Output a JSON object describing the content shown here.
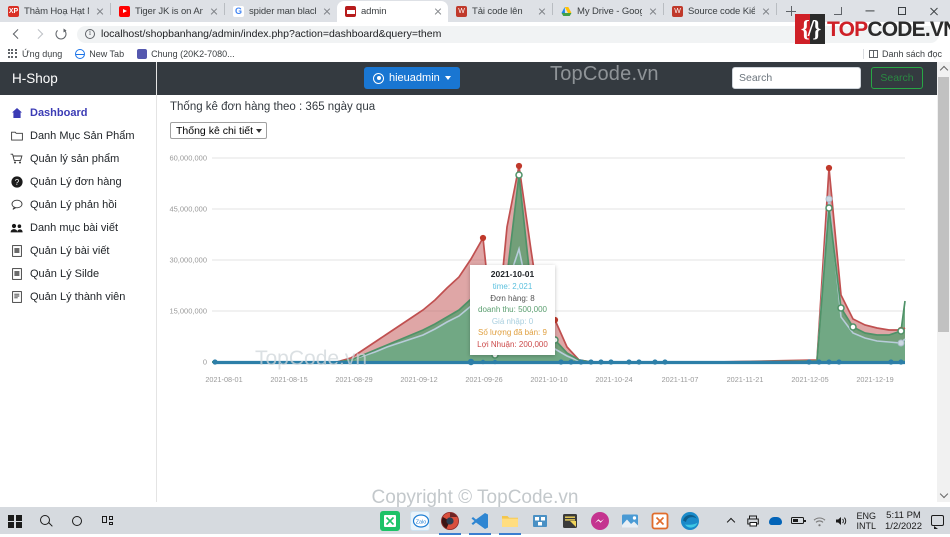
{
  "browser": {
    "tabs": [
      {
        "title": "Thảm Hoạ Hạt Nhân",
        "favicon": "xp-icon",
        "active": false
      },
      {
        "title": "Tiger JK is on Another",
        "favicon": "youtube-icon",
        "active": false
      },
      {
        "title": "spider man black hình",
        "favicon": "google-icon",
        "active": false
      },
      {
        "title": "admin",
        "favicon": "admin-icon",
        "active": true
      },
      {
        "title": "Tải code lên",
        "favicon": "word-icon",
        "active": false
      },
      {
        "title": "My Drive - Google Dr",
        "favicon": "google-drive-icon",
        "active": false
      },
      {
        "title": "Source code Kiểm tra",
        "favicon": "word-icon",
        "active": false
      }
    ],
    "new_tab_label": "+",
    "url": "localhost/shopbanhang/admin/index.php?action=dashboard&query=them",
    "bookmarks": [
      {
        "label": "Ứng dụng",
        "icon": "apps-grid-icon"
      },
      {
        "label": "New Tab",
        "icon": "globe-icon"
      },
      {
        "label": "Chung (20K2-7080...",
        "icon": "teams-icon"
      }
    ],
    "reading_list_label": "Danh sách đọc"
  },
  "watermark": {
    "logo_part1": "TOP",
    "logo_part2": "CODE.VN",
    "logo_brace": "{/}",
    "navbar_text": "TopCode.vn",
    "chart_text": "TopCode.vn",
    "copyright_text": "Copyright © TopCode.vn"
  },
  "sidebar": {
    "brand": "H-Shop",
    "items": [
      {
        "label": "Dashboard",
        "icon": "home-icon",
        "glyph": "⌂",
        "active": true
      },
      {
        "label": "Danh Mục Sản Phẩm",
        "icon": "folder-icon",
        "glyph": "὜0",
        "active": false
      },
      {
        "label": "Quản lý sản phẩm",
        "icon": "cart-icon",
        "glyph": "Ὥ2",
        "active": false
      },
      {
        "label": "Quản Lý đơn hàng",
        "icon": "question-circle-icon",
        "glyph": "❓",
        "active": false
      },
      {
        "label": "Quản Lý phản hồi",
        "icon": "comment-icon",
        "glyph": "὞8",
        "active": false
      },
      {
        "label": "Danh mục bài viết",
        "icon": "users-icon",
        "glyph": "὆5",
        "active": false
      },
      {
        "label": "Quản Lý bài viết",
        "icon": "file-icon",
        "glyph": "὜E",
        "active": false
      },
      {
        "label": "Quản Lý Silde",
        "icon": "file-icon",
        "glyph": "὜E",
        "active": false
      },
      {
        "label": "Quản Lý thành viên",
        "icon": "file-icon",
        "glyph": "὜E",
        "active": false
      }
    ]
  },
  "navbar": {
    "user_label": "hieuadmin",
    "search_placeholder": "Search",
    "search_value": "",
    "search_button": "Search",
    "accent_blue": "#1976d2",
    "accent_green": "#28a745"
  },
  "main": {
    "heading": "Thống kê đơn hàng theo : 365 ngày qua",
    "select_value": "Thống kê chi tiết"
  },
  "tooltip": {
    "title": "2021-10-01",
    "rows": [
      {
        "label": "time",
        "value": "2,021",
        "color": "#5bc0de"
      },
      {
        "label": "Đơn hàng",
        "value": "8",
        "color": "#555555"
      },
      {
        "label": "doanh thu",
        "value": "500,000",
        "color": "#5a9e6f"
      },
      {
        "label": "Giá nhập",
        "value": "0",
        "color": "#9fcfe0"
      },
      {
        "label": "Số lượng đã bán",
        "value": "9",
        "color": "#e8a33d"
      },
      {
        "label": "Lợi Nhuận",
        "value": "200,000",
        "color": "#cc4b4b"
      }
    ]
  },
  "chart_data": {
    "type": "area",
    "title": "Thống kê đơn hàng theo : 365 ngày qua",
    "xlabel": "",
    "ylabel": "",
    "ylim": [
      0,
      60000000
    ],
    "yticks": [
      0,
      15000000,
      30000000,
      45000000,
      60000000
    ],
    "ytick_labels": [
      "0",
      "15,000,000",
      "30,000,000",
      "45,000,000",
      "60,000,000"
    ],
    "grid": true,
    "legend": "none",
    "xtick_labels": [
      "2021-08-01",
      "2021-08-15",
      "2021-08-29",
      "2021-09-12",
      "2021-09-26",
      "2021-10-10",
      "2021-10-24",
      "2021-11-07",
      "2021-11-21",
      "2021-12-05",
      "2021-12-19"
    ],
    "series": [
      {
        "name": "doanh thu",
        "color": "#5a9e6f",
        "fill": "rgba(92,158,111,0.75)",
        "values": [
          0,
          0,
          0,
          0,
          0,
          0,
          0,
          0,
          0,
          0,
          0,
          0,
          0,
          0,
          0,
          0,
          0,
          0,
          0,
          0,
          0,
          0,
          500000,
          2000000,
          3500000,
          5000000,
          6500000,
          8000000,
          9500000,
          11000000,
          13000000,
          15500000,
          18000000,
          22000000,
          26000000,
          2000000,
          30000000,
          55000000,
          22000000,
          5500000,
          6500000,
          3000000,
          500000,
          0,
          0,
          0,
          0,
          0,
          0,
          0,
          0,
          0,
          0,
          0,
          0,
          0,
          0,
          0,
          0,
          0,
          0,
          0,
          0,
          0,
          0,
          0,
          0,
          0,
          0,
          0,
          0,
          0,
          0,
          0,
          0,
          0,
          0,
          500000,
          45000000,
          16000000,
          10000000,
          8000000,
          7500000,
          7000000,
          7000000,
          7500000,
          9000000,
          18000000,
          1000000,
          0
        ]
      },
      {
        "name": "Lợi Nhuận",
        "color": "#cc4b4b",
        "fill": "rgba(196,92,92,0.55)",
        "values": [
          0,
          0,
          0,
          0,
          0,
          0,
          0,
          0,
          0,
          0,
          0,
          0,
          0,
          0,
          0,
          0,
          0,
          0,
          0,
          0,
          0,
          0,
          800000,
          2600000,
          4300000,
          6000000,
          7800000,
          9500000,
          11200000,
          13000000,
          15200000,
          18000000,
          20500000,
          25000000,
          30000000,
          2500000,
          34000000,
          58000000,
          25000000,
          7500000,
          9500000,
          3500000,
          700000,
          0,
          0,
          0,
          0,
          0,
          0,
          0,
          0,
          0,
          0,
          0,
          0,
          0,
          0,
          0,
          0,
          0,
          0,
          0,
          0,
          0,
          0,
          0,
          0,
          0,
          0,
          0,
          0,
          0,
          0,
          0,
          0,
          0,
          0,
          700000,
          58000000,
          20000000,
          13000000,
          11000000,
          10000000,
          9500000,
          9500000,
          10000000,
          12000000,
          22000000,
          1200000,
          0
        ]
      },
      {
        "name": "Giá nhập",
        "color": "#a8c4d8",
        "fill": "rgba(200,215,228,0.9)",
        "values": [
          0,
          0,
          0,
          0,
          0,
          0,
          0,
          0,
          0,
          0,
          0,
          0,
          0,
          0,
          0,
          0,
          0,
          0,
          0,
          0,
          0,
          0,
          300000,
          1200000,
          2100000,
          3000000,
          3900000,
          4800000,
          5700000,
          6600000,
          7800000,
          9300000,
          10800000,
          13200000,
          15600000,
          1200000,
          18000000,
          33000000,
          13200000,
          3300000,
          3900000,
          1800000,
          300000,
          0,
          0,
          0,
          0,
          0,
          0,
          0,
          0,
          0,
          0,
          0,
          0,
          0,
          0,
          0,
          0,
          0,
          0,
          0,
          0,
          0,
          0,
          0,
          0,
          0,
          0,
          0,
          0,
          0,
          0,
          0,
          0,
          0,
          0,
          300000,
          48000000,
          13000000,
          8500000,
          7000000,
          6500000,
          6200000,
          6200000,
          6500000,
          8000000,
          16000000,
          800000,
          0
        ]
      },
      {
        "name": "time",
        "color": "#2d7fa8",
        "fill": "none",
        "values": "flat-baseline"
      }
    ]
  },
  "taskbar": {
    "system_icons": [
      "start-icon",
      "search-icon",
      "cortana-icon",
      "task-view-icon"
    ],
    "apps": [
      {
        "name": "excel-icon",
        "color": "#1dc267"
      },
      {
        "name": "zalo-icon",
        "color": "#e8f3fb"
      },
      {
        "name": "chrome-icon",
        "color": "#8b2a2a"
      },
      {
        "name": "vscode-icon",
        "color": "#2f7fc1"
      },
      {
        "name": "file-explorer-icon",
        "color": "#f0c14b"
      },
      {
        "name": "xampp-icon",
        "color": "#e9a23b"
      },
      {
        "name": "notepad-icon",
        "color": "#3a3a3a"
      },
      {
        "name": "messenger-icon",
        "color": "#c4338f"
      },
      {
        "name": "photos-icon",
        "color": "#3b7ed0"
      },
      {
        "name": "xampp-control-icon",
        "color": "#e06c2b"
      },
      {
        "name": "edge-icon",
        "color": "#1a8ac9"
      }
    ],
    "tray": {
      "language": "ENG",
      "language_sub": "INTL",
      "time": "5:11 PM",
      "date": "1/2/2022"
    }
  }
}
